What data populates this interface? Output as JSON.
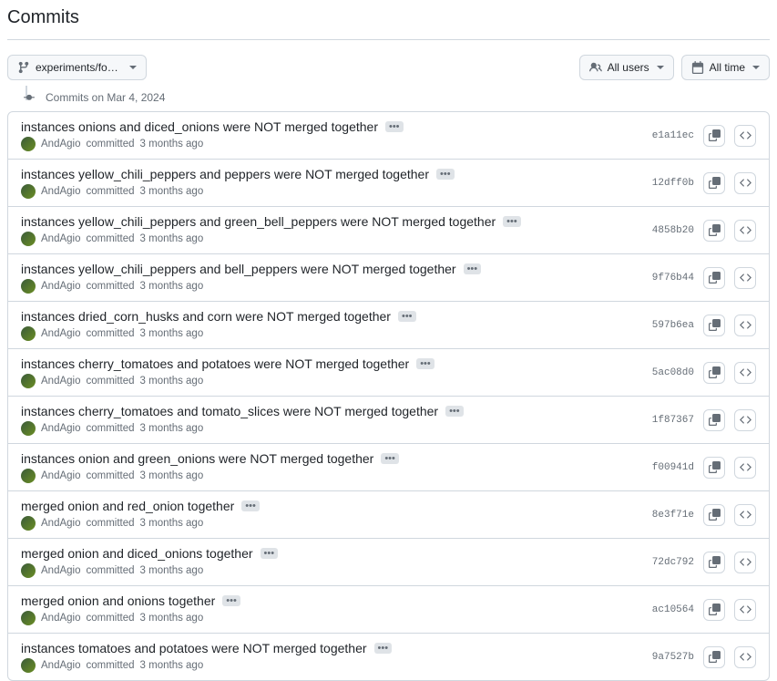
{
  "page_title": "Commits",
  "branch_selector": {
    "label": "experiments/food..."
  },
  "filters": {
    "users": "All users",
    "time": "All time"
  },
  "date_header": "Commits on Mar 4, 2024",
  "committed_word": "committed",
  "commits": [
    {
      "title": "instances onions and diced_onions were NOT merged together",
      "author": "AndAgio",
      "when": "3 months ago",
      "sha": "e1a11ec"
    },
    {
      "title": "instances yellow_chili_peppers and peppers were NOT merged together",
      "author": "AndAgio",
      "when": "3 months ago",
      "sha": "12dff0b"
    },
    {
      "title": "instances yellow_chili_peppers and green_bell_peppers were NOT merged together",
      "author": "AndAgio",
      "when": "3 months ago",
      "sha": "4858b20"
    },
    {
      "title": "instances yellow_chili_peppers and bell_peppers were NOT merged together",
      "author": "AndAgio",
      "when": "3 months ago",
      "sha": "9f76b44"
    },
    {
      "title": "instances dried_corn_husks and corn were NOT merged together",
      "author": "AndAgio",
      "when": "3 months ago",
      "sha": "597b6ea"
    },
    {
      "title": "instances cherry_tomatoes and potatoes were NOT merged together",
      "author": "AndAgio",
      "when": "3 months ago",
      "sha": "5ac08d0"
    },
    {
      "title": "instances cherry_tomatoes and tomato_slices were NOT merged together",
      "author": "AndAgio",
      "when": "3 months ago",
      "sha": "1f87367"
    },
    {
      "title": "instances onion and green_onions were NOT merged together",
      "author": "AndAgio",
      "when": "3 months ago",
      "sha": "f00941d"
    },
    {
      "title": "merged onion and red_onion together",
      "author": "AndAgio",
      "when": "3 months ago",
      "sha": "8e3f71e"
    },
    {
      "title": "merged onion and diced_onions together",
      "author": "AndAgio",
      "when": "3 months ago",
      "sha": "72dc792"
    },
    {
      "title": "merged onion and onions together",
      "author": "AndAgio",
      "when": "3 months ago",
      "sha": "ac10564"
    },
    {
      "title": "instances tomatoes and potatoes were NOT merged together",
      "author": "AndAgio",
      "when": "3 months ago",
      "sha": "9a7527b"
    }
  ]
}
